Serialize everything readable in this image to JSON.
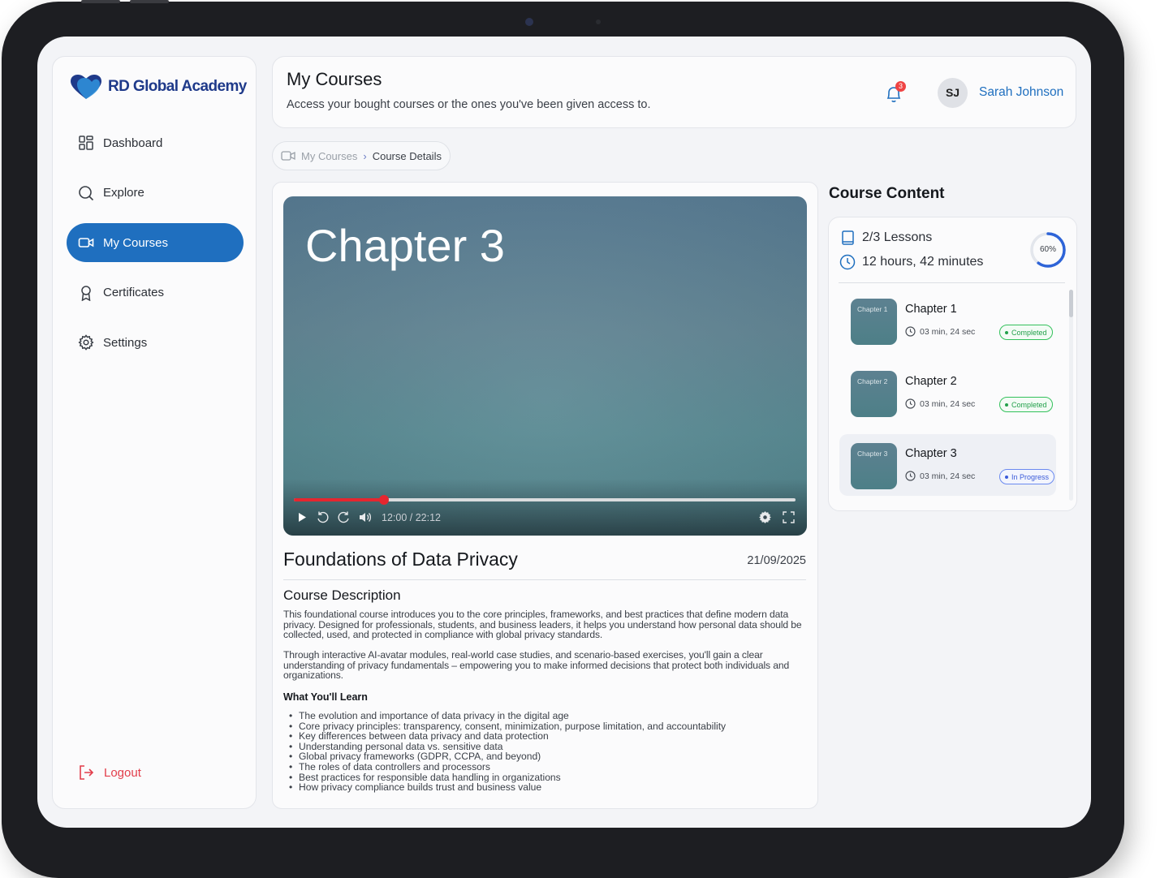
{
  "app": {
    "brand": "RD Global Academy",
    "colors": {
      "primary": "#1f6fbf",
      "danger": "#e23d4a",
      "success": "#22a04a",
      "info": "#3b5bd9",
      "brand_text": "#1f3a8a"
    }
  },
  "sidebar": {
    "items": [
      {
        "label": "Dashboard",
        "icon": "grid-icon"
      },
      {
        "label": "Explore",
        "icon": "search-icon"
      },
      {
        "label": "My Courses",
        "icon": "video-camera-icon",
        "active": true
      },
      {
        "label": "Certificates",
        "icon": "award-icon"
      },
      {
        "label": "Settings",
        "icon": "gear-icon"
      }
    ],
    "logout_label": "Logout"
  },
  "header": {
    "title": "My Courses",
    "subtitle": "Access your bought courses or the ones you've been given access to.",
    "notification_count": "3",
    "user_initials": "SJ",
    "user_name": "Sarah Johnson"
  },
  "breadcrumb": {
    "parent": "My Courses",
    "current": "Course Details"
  },
  "video": {
    "title": "Chapter 3",
    "time": "12:00 / 22:12",
    "progress": 0.18
  },
  "course": {
    "title": "Foundations of Data Privacy",
    "date": "21/09/2025",
    "description_heading": "Course Description",
    "paragraph1": "This foundational course introduces you to the core principles, frameworks, and best practices that define modern data privacy. Designed for professionals, students, and business leaders, it helps you understand how personal data should be collected, used, and protected in compliance with global privacy standards.",
    "paragraph2": "Through interactive AI-avatar modules, real-world case studies, and scenario-based exercises, you'll gain a clear understanding of privacy fundamentals – empowering you to make informed decisions that protect both individuals and organizations.",
    "learn_heading": "What You'll Learn",
    "learn_items": [
      "The evolution and importance of data privacy in the digital age",
      "Core privacy principles: transparency, consent, minimization, purpose limitation, and accountability",
      "Key differences between data privacy and data protection",
      "Understanding personal data vs. sensitive data",
      "Global privacy frameworks (GDPR, CCPA, and beyond)",
      "The roles of data controllers and processors",
      "Best practices for responsible data handling in organizations",
      "How privacy compliance builds trust and business value"
    ]
  },
  "course_content": {
    "title": "Course Content",
    "lessons_stat": "2/3 Lessons",
    "duration_stat": "12 hours, 42 minutes",
    "progress_label": "60%",
    "progress": 0.6,
    "lessons": [
      {
        "thumb": "Chapter 1",
        "title": "Chapter 1",
        "duration": "03 min, 24 sec",
        "status": "Completed",
        "state": "completed"
      },
      {
        "thumb": "Chapter 2",
        "title": "Chapter 2",
        "duration": "03 min, 24 sec",
        "status": "Completed",
        "state": "completed"
      },
      {
        "thumb": "Chapter 3",
        "title": "Chapter 3",
        "duration": "03 min, 24 sec",
        "status": "In Progress",
        "state": "progress"
      }
    ]
  }
}
